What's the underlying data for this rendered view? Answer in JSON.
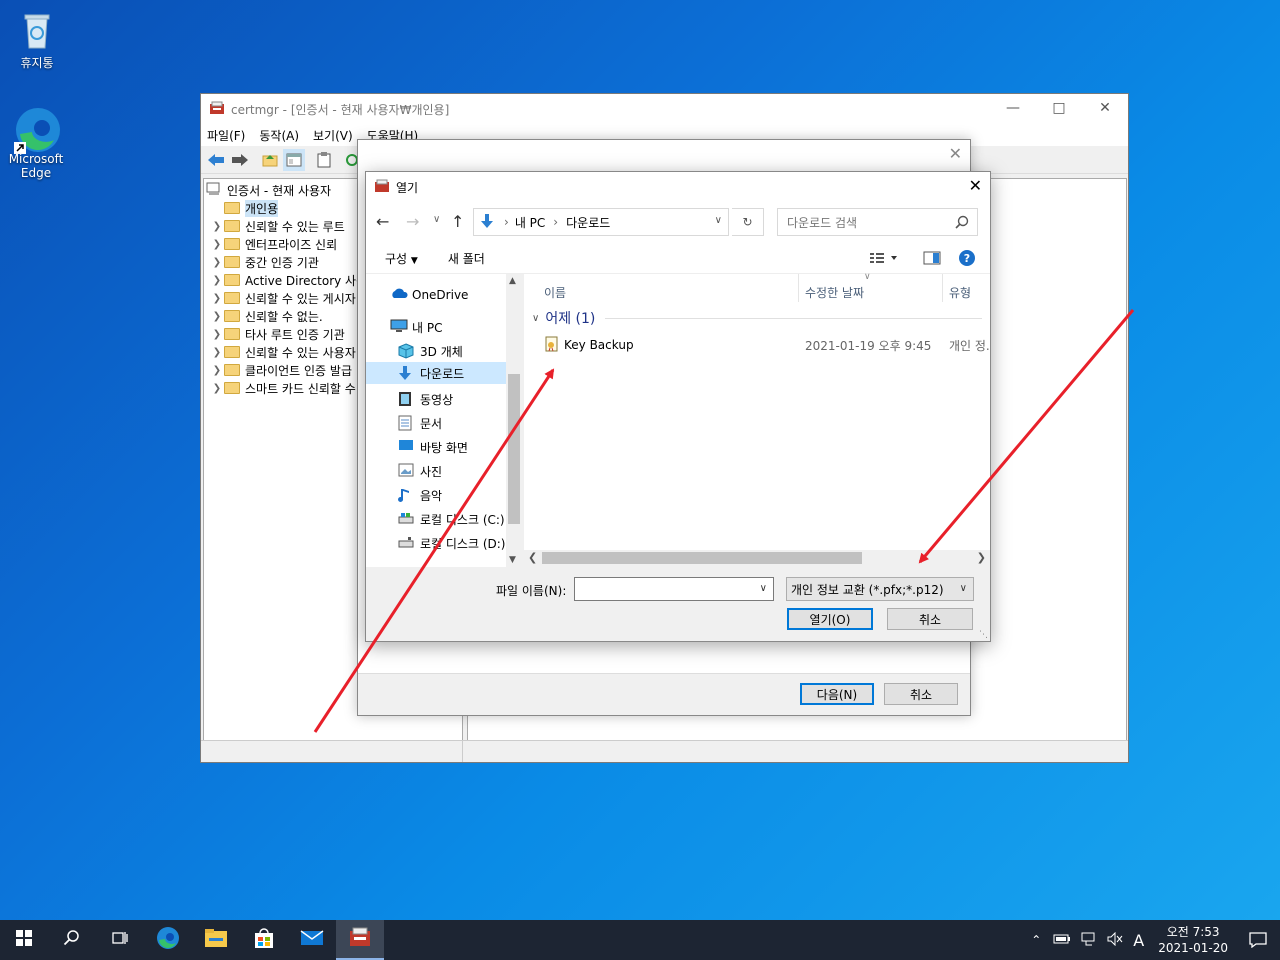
{
  "desktop": {
    "recycle_bin_label": "휴지통",
    "edge_label_line1": "Microsoft",
    "edge_label_line2": "Edge"
  },
  "mmc": {
    "title": "certmgr - [인증서 - 현재 사용자₩개인용]",
    "menu": [
      "파일(F)",
      "동작(A)",
      "보기(V)",
      "도움말(H)"
    ],
    "tree_root": "인증서 - 현재 사용자",
    "tree_items": [
      "개인용",
      "신뢰할 수 있는 루트",
      "엔터프라이즈 신뢰",
      "중간 인증 기관",
      "Active Directory 사용",
      "신뢰할 수 있는 게시자",
      "신뢰할 수 없는.",
      "타사 루트 인증 기관",
      "신뢰할 수 있는 사용자",
      "클라이언트 인증 발급",
      "스마트 카드 신뢰할 수"
    ]
  },
  "wizard": {
    "next_label": "다음(N)",
    "cancel_label": "취소"
  },
  "dialog": {
    "title": "열기",
    "breadcrumb": [
      "내 PC",
      "다운로드"
    ],
    "search_placeholder": "다운로드 검색",
    "organize_label": "구성",
    "new_folder_label": "새 폴더",
    "columns": {
      "name": "이름",
      "modified": "수정한 날짜",
      "type": "유형"
    },
    "group_header": "어제 (1)",
    "files": [
      {
        "name": "Key Backup",
        "modified": "2021-01-19 오후 9:45",
        "type": "개인 정."
      }
    ],
    "nav_items": [
      {
        "label": "OneDrive",
        "icon": "onedrive-icon"
      },
      {
        "label": "내 PC",
        "icon": "pc-icon"
      },
      {
        "label": "3D 개체",
        "icon": "3d-objects-icon"
      },
      {
        "label": "다운로드",
        "icon": "downloads-icon"
      },
      {
        "label": "동영상",
        "icon": "videos-icon"
      },
      {
        "label": "문서",
        "icon": "documents-icon"
      },
      {
        "label": "바탕 화면",
        "icon": "desktop-icon"
      },
      {
        "label": "사진",
        "icon": "pictures-icon"
      },
      {
        "label": "음악",
        "icon": "music-icon"
      },
      {
        "label": "로컬 디스크 (C:)",
        "icon": "drive-icon"
      },
      {
        "label": "로컬 디스크 (D:)",
        "icon": "drive-icon"
      }
    ],
    "filename_label": "파일 이름(N):",
    "filename_value": "",
    "filetype_value": "개인 정보 교환 (*.pfx;*.p12)",
    "open_label": "열기(O)",
    "cancel_label": "취소"
  },
  "taskbar": {
    "clock_time": "오전 7:53",
    "clock_date": "2021-01-20",
    "ime_label": "A"
  },
  "colors": {
    "accent": "#0078d7",
    "arrow": "#e8202a",
    "selection": "#cce8ff"
  }
}
